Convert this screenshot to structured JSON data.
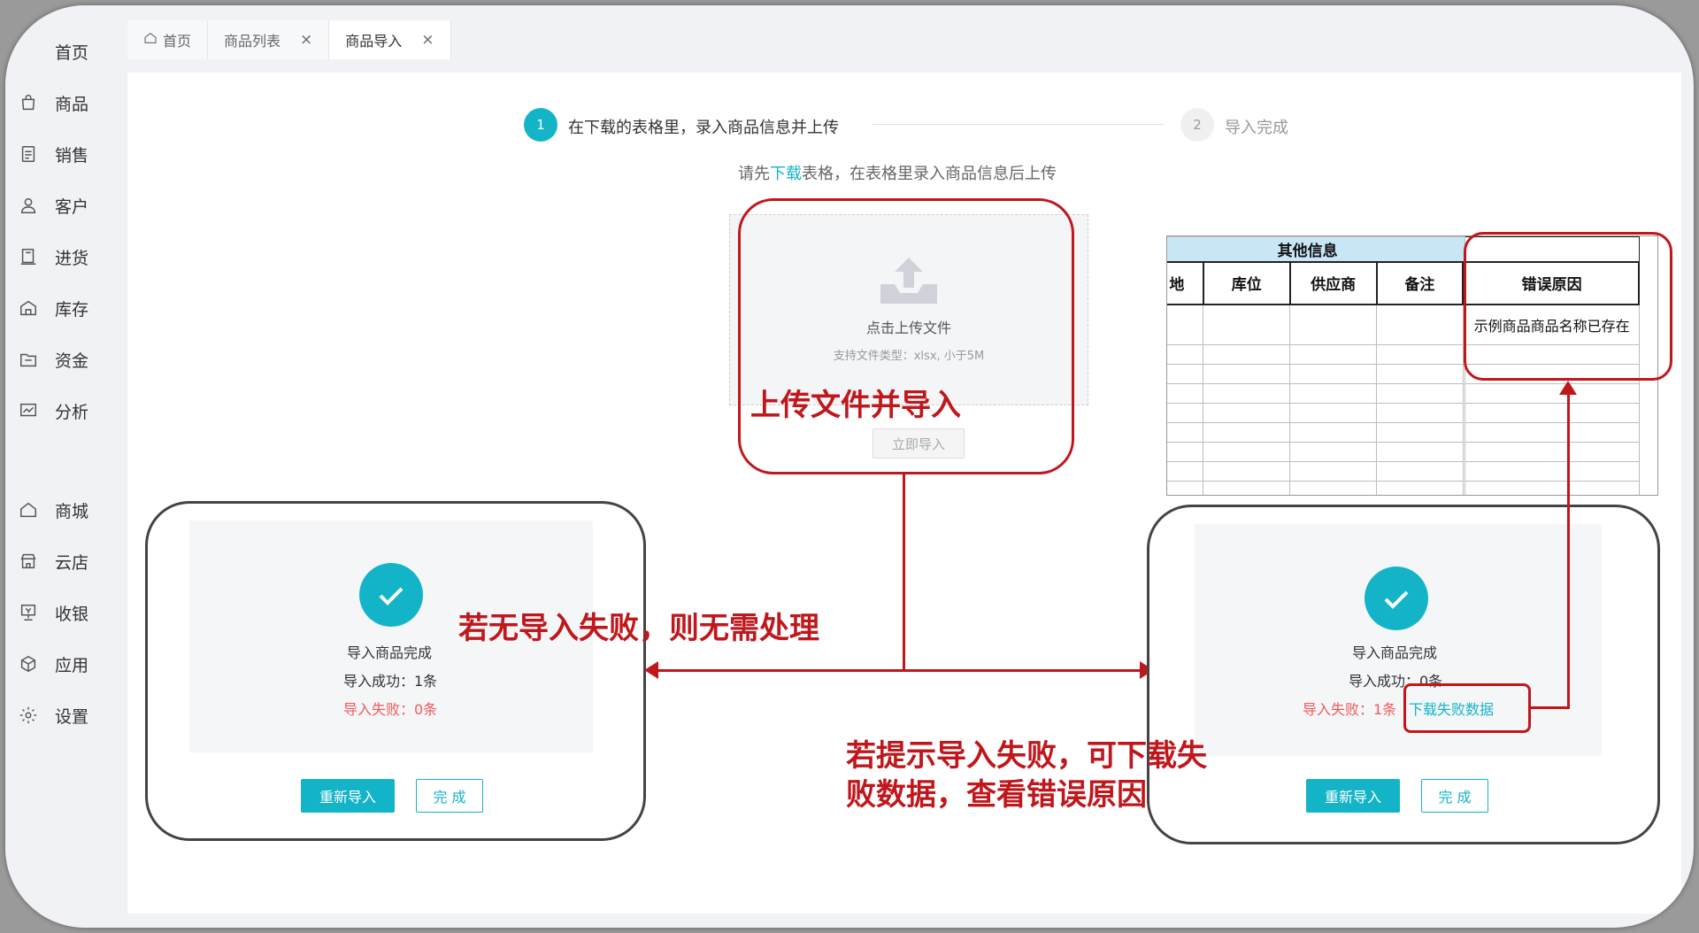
{
  "sidebar": {
    "items": [
      {
        "label": "首页",
        "icon": "home-icon"
      },
      {
        "label": "商品",
        "icon": "bag-icon"
      },
      {
        "label": "销售",
        "icon": "document-icon"
      },
      {
        "label": "客户",
        "icon": "user-icon"
      },
      {
        "label": "进货",
        "icon": "ledger-icon"
      },
      {
        "label": "库存",
        "icon": "warehouse-icon"
      },
      {
        "label": "资金",
        "icon": "folder-icon"
      },
      {
        "label": "分析",
        "icon": "chart-icon"
      },
      {
        "label": "商城",
        "icon": "shop-icon"
      },
      {
        "label": "云店",
        "icon": "store-icon"
      },
      {
        "label": "收银",
        "icon": "cashier-icon"
      },
      {
        "label": "应用",
        "icon": "cube-icon"
      },
      {
        "label": "设置",
        "icon": "gear-icon"
      }
    ]
  },
  "tabs": [
    {
      "label": "首页"
    },
    {
      "label": "商品列表"
    },
    {
      "label": "商品导入"
    }
  ],
  "tab_close": "×",
  "steps": {
    "step1_num": "1",
    "step1_label": "在下载的表格里，录入商品信息并上传",
    "step2_num": "2",
    "step2_label": "导入完成"
  },
  "hint": {
    "prefix": "请先",
    "link": "下载",
    "suffix": "表格，在表格里录入商品信息后上传"
  },
  "upload": {
    "title": "点击上传文件",
    "sub": "支持文件类型：xlsx, 小于5M",
    "import_now": "立即导入"
  },
  "annotations": {
    "upload": "上传文件并导入",
    "no_fail": "若无导入失败，则无需处理",
    "fail_line1": "若提示导入失败，可下载失",
    "fail_line2": "败数据，查看错误原因"
  },
  "result_left": {
    "title": "导入商品完成",
    "success": "导入成功：1条",
    "fail": "导入失败：0条",
    "reimport": "重新导入",
    "done": "完 成"
  },
  "result_right": {
    "title": "导入商品完成",
    "success": "导入成功：0条",
    "fail": "导入失败：1条",
    "download_fail": "下载失败数据",
    "reimport": "重新导入",
    "done": "完 成"
  },
  "excel": {
    "group_header": "其他信息",
    "partial_col": "地",
    "columns": [
      "库位",
      "供应商",
      "备注",
      "错误原因"
    ],
    "error_reason": "示例商品商品名称已存在"
  },
  "colors": {
    "accent": "#14b4c8",
    "annotation": "#c0171c",
    "fail": "#f05a5a"
  }
}
